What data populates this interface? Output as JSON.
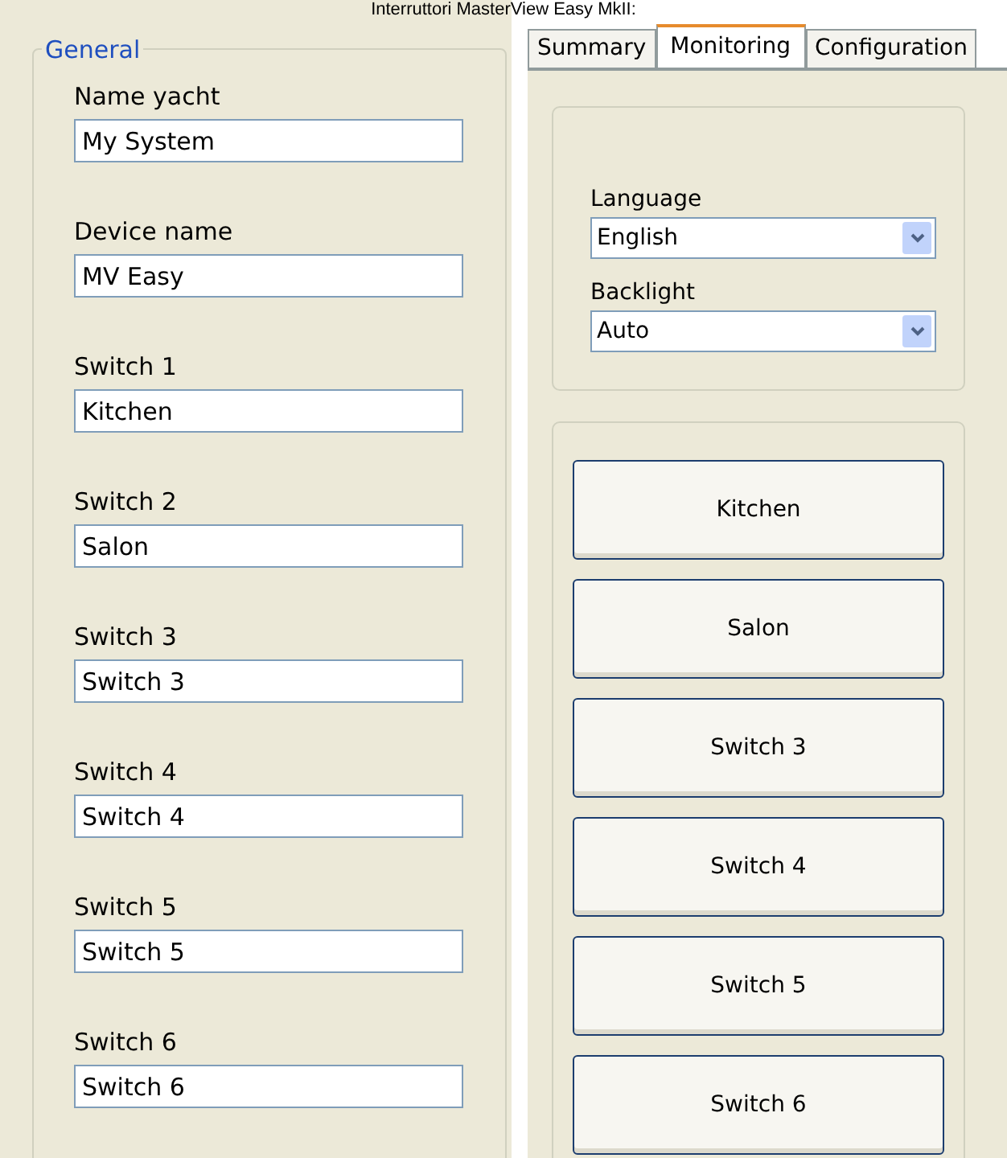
{
  "caption": "Interruttori MasterView Easy MkII:",
  "general": {
    "title": "General",
    "fields": [
      {
        "label": "Name yacht",
        "value": "My System"
      },
      {
        "label": "Device name",
        "value": "MV Easy"
      },
      {
        "label": "Switch 1",
        "value": "Kitchen"
      },
      {
        "label": "Switch 2",
        "value": "Salon"
      },
      {
        "label": "Switch 3",
        "value": "Switch 3"
      },
      {
        "label": "Switch 4",
        "value": "Switch 4"
      },
      {
        "label": "Switch 5",
        "value": "Switch 5"
      },
      {
        "label": "Switch 6",
        "value": "Switch 6"
      }
    ]
  },
  "tabs": [
    {
      "label": "Summary",
      "selected": false
    },
    {
      "label": "Monitoring",
      "selected": true
    },
    {
      "label": "Configuration",
      "selected": false
    }
  ],
  "settings": [
    {
      "label": "Language",
      "value": "English"
    },
    {
      "label": "Backlight",
      "value": "Auto"
    }
  ],
  "switch_buttons": [
    "Kitchen",
    "Salon",
    "Switch 3",
    "Switch 4",
    "Switch 5",
    "Switch 6"
  ]
}
